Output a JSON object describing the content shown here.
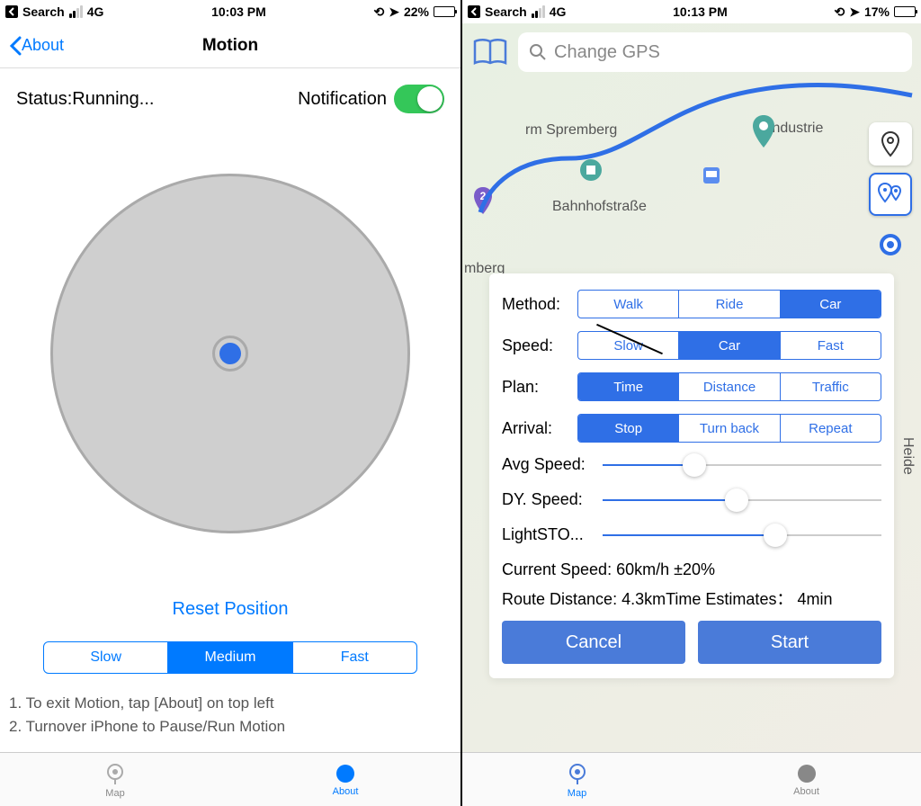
{
  "left": {
    "status_bar": {
      "back": "Search",
      "net": "4G",
      "time": "10:03 PM",
      "battery": "22%",
      "batfill": 22
    },
    "nav": {
      "back": "About",
      "title": "Motion"
    },
    "status": "Status:Running...",
    "notif_label": "Notification",
    "reset": "Reset Position",
    "speeds": [
      "Slow",
      "Medium",
      "Fast"
    ],
    "speed_selected": 1,
    "tips": [
      "1. To exit Motion, tap [About] on top left",
      "2. Turnover iPhone to Pause/Run Motion"
    ],
    "tabs": {
      "map": "Map",
      "about": "About"
    }
  },
  "right": {
    "status_bar": {
      "back": "Search",
      "net": "4G",
      "time": "10:13 PM",
      "battery": "17%",
      "batfill": 17
    },
    "search_placeholder": "Change GPS",
    "map_labels": {
      "spremberg": "rm Spremberg",
      "industrie": "Industrie",
      "bahnhof": "Bahnhofstraße",
      "heide": "Heide",
      "mberg": "mberg"
    },
    "panel": {
      "method": {
        "label": "Method:",
        "opts": [
          "Walk",
          "Ride",
          "Car"
        ],
        "sel": 2
      },
      "speed": {
        "label": "Speed:",
        "opts": [
          "Slow",
          "Car",
          "Fast"
        ],
        "sel": 1
      },
      "plan": {
        "label": "Plan:",
        "opts": [
          "Time",
          "Distance",
          "Traffic"
        ],
        "sel": 0
      },
      "arrival": {
        "label": "Arrival:",
        "opts": [
          "Stop",
          "Turn back",
          "Repeat"
        ],
        "sel": 0
      },
      "sliders": {
        "avg": "Avg Speed:",
        "dy": "DY. Speed:",
        "light": "LightSTO..."
      },
      "current": "Current Speed: 60km/h ±20%",
      "route_dist": "Route Distance: 4.3km",
      "time_est": "Time Estimates： 4min",
      "cancel": "Cancel",
      "start": "Start"
    },
    "tabs": {
      "map": "Map",
      "about": "About"
    }
  }
}
